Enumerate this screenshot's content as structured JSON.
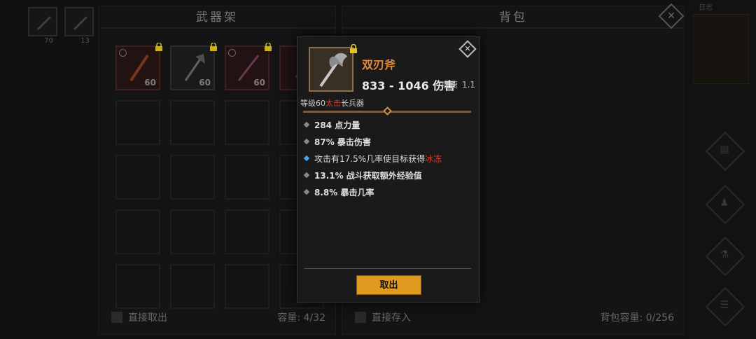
{
  "top_slots": [
    {
      "count": "70"
    },
    {
      "count": "13"
    }
  ],
  "left_panel": {
    "title": "武器架",
    "slots": [
      {
        "level": "60",
        "style": "filled"
      },
      {
        "level": "60",
        "style": "grey"
      },
      {
        "level": "60",
        "style": "filled"
      },
      {
        "level": "",
        "style": "filled"
      }
    ],
    "footer_label": "直接取出",
    "capacity": "容量: 4/32"
  },
  "right_panel": {
    "title": "背包",
    "footer_label": "直接存入",
    "capacity": "背包容量: 0/256",
    "close_glyph": "✕"
  },
  "right_strip": {
    "label": "日志"
  },
  "modal": {
    "item_name": "双刃斧",
    "damage": "833 - 1046 伤害",
    "speed_label": "攻速",
    "speed_value": "1.1",
    "level_prefix": "等级60",
    "level_red": "太击",
    "level_suffix": "长兵器",
    "stats": [
      {
        "text": "284 点力量",
        "special": false
      },
      {
        "text": "87% 暴击伤害",
        "special": false
      },
      {
        "text": "攻击有17.5%几率使目标获得",
        "red": "冰冻",
        "special": true
      },
      {
        "text": "13.1% 战斗获取额外经验值",
        "special": false
      },
      {
        "text": "8.8% 暴击几率",
        "special": false
      }
    ],
    "button_label": "取出",
    "close_glyph": "✕"
  },
  "colors": {
    "accent_orange": "#e28a3b",
    "button_gold": "#e09a1f",
    "red_text": "#d83d2e",
    "special_bullet": "#4aa3e6"
  }
}
